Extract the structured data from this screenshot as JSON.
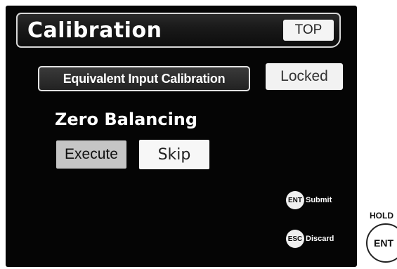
{
  "screen": {
    "title": "Calibration",
    "top_button": "TOP",
    "equivalent_button": "Equivalent Input Calibration",
    "locked_button": "Locked",
    "zero_label": "Zero Balancing",
    "execute_button": "Execute",
    "skip_button": "Skip",
    "ent_key": "ENT",
    "submit_label": "Submit",
    "esc_key": "ESC",
    "discard_label": "Discard"
  },
  "hardware": {
    "hold_label": "HOLD",
    "ent_button": "ENT"
  }
}
